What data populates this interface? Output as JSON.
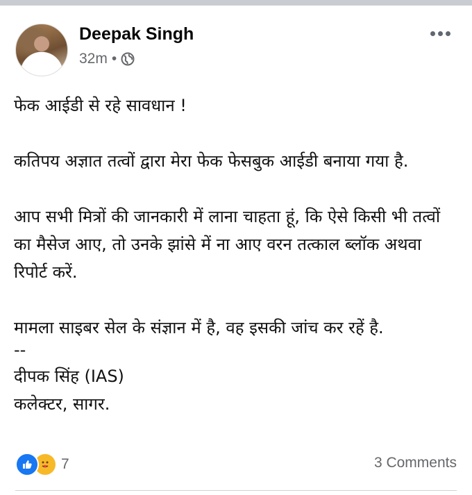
{
  "post": {
    "author": "Deepak Singh",
    "time": "32m",
    "separator": "•",
    "privacy_icon": "globe-icon",
    "more_icon": "more-horizontal-icon",
    "body": {
      "line1": "फेक आईडी से रहे सावधान !",
      "line2": "कतिपय अज्ञात तत्वों द्वारा मेरा फेक फेसबुक आईडी बनाया गया है.",
      "line3": "आप सभी मित्रों की जानकारी में लाना चाहता हूं, कि ऐसे किसी भी तत्वों का मैसेज आए, तो उनके झांसे में ना आए वरन तत्काल ब्लॉक अथवा रिपोर्ट करें.",
      "line4": "मामला साइबर सेल के संज्ञान में है, वह इसकी जांच कर रहें है.",
      "dashes": "--",
      "signature_name": "दीपक सिंह (IAS)",
      "signature_title": "कलेक्टर, सागर."
    },
    "reactions": {
      "types": [
        "like",
        "care"
      ],
      "count": "7"
    },
    "comments": "3 Comments"
  },
  "colors": {
    "like_blue": "#1877f2",
    "care_yellow": "#f7b928",
    "secondary_text": "#65676b"
  }
}
